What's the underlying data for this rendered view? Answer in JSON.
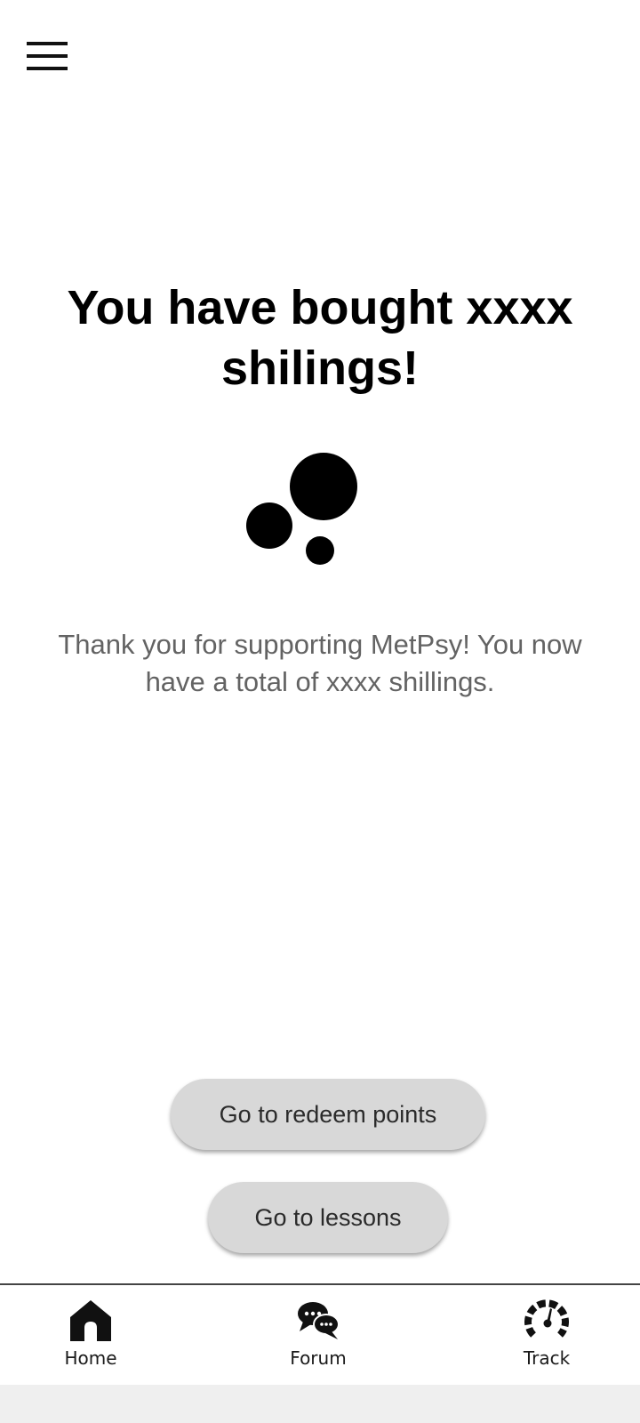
{
  "header": {
    "menu_icon": "hamburger-menu-icon"
  },
  "main": {
    "headline": "You have bought xxxx shilings!",
    "illustration_icon": "coins-icon",
    "message": "Thank you for supporting MetPsy! You now have a total of xxxx shillings."
  },
  "actions": {
    "redeem_label": "Go to redeem points",
    "lessons_label": "Go to lessons"
  },
  "bottom_nav": {
    "items": [
      {
        "label": "Home",
        "icon": "home-icon"
      },
      {
        "label": "Forum",
        "icon": "chat-bubbles-icon"
      },
      {
        "label": "Track",
        "icon": "speedometer-icon"
      }
    ]
  }
}
